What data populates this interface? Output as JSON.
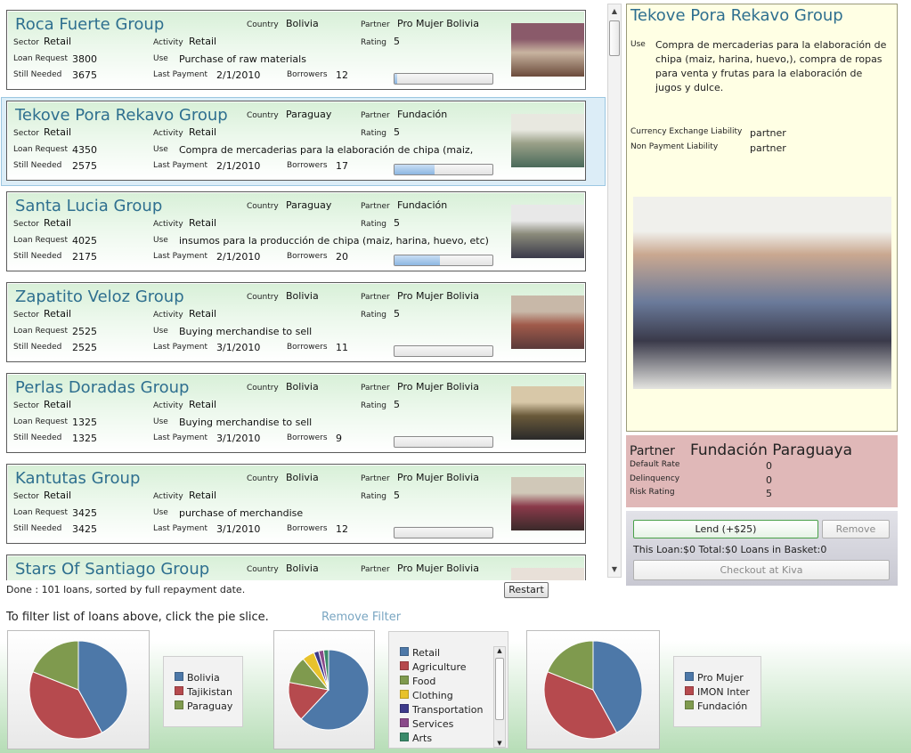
{
  "loans": [
    {
      "name": "Roca Fuerte Group",
      "country": "Bolivia",
      "partner": "Pro Mujer Bolivia",
      "sector": "Retail",
      "activity": "Retail",
      "rating": "5",
      "loan_request": "3800",
      "use": "Purchase of raw materials",
      "still_needed": "3675",
      "last_payment": "2/1/2010",
      "borrowers": "12",
      "funded_fraction": 0.03
    },
    {
      "name": "Tekove Pora Rekavo Group",
      "country": "Paraguay",
      "partner": "Fundación",
      "sector": "Retail",
      "activity": "Retail",
      "rating": "5",
      "loan_request": "4350",
      "use": "Compra de mercaderias para la elaboración de chipa (maiz,",
      "still_needed": "2575",
      "last_payment": "2/1/2010",
      "borrowers": "17",
      "funded_fraction": 0.41
    },
    {
      "name": "Santa Lucia Group",
      "country": "Paraguay",
      "partner": "Fundación",
      "sector": "Retail",
      "activity": "Retail",
      "rating": "5",
      "loan_request": "4025",
      "use": "insumos para la producción de chipa (maiz, harina, huevo, etc)",
      "still_needed": "2175",
      "last_payment": "2/1/2010",
      "borrowers": "20",
      "funded_fraction": 0.46
    },
    {
      "name": "Zapatito Veloz Group",
      "country": "Bolivia",
      "partner": "Pro Mujer Bolivia",
      "sector": "Retail",
      "activity": "Retail",
      "rating": "5",
      "loan_request": "2525",
      "use": "Buying merchandise to sell",
      "still_needed": "2525",
      "last_payment": "3/1/2010",
      "borrowers": "11",
      "funded_fraction": 0.0
    },
    {
      "name": "Perlas Doradas Group",
      "country": "Bolivia",
      "partner": "Pro Mujer Bolivia",
      "sector": "Retail",
      "activity": "Retail",
      "rating": "5",
      "loan_request": "1325",
      "use": "Buying merchandise to sell",
      "still_needed": "1325",
      "last_payment": "3/1/2010",
      "borrowers": "9",
      "funded_fraction": 0.0
    },
    {
      "name": "Kantutas Group",
      "country": "Bolivia",
      "partner": "Pro Mujer Bolivia",
      "sector": "Retail",
      "activity": "Retail",
      "rating": "5",
      "loan_request": "3425",
      "use": "purchase of merchandise",
      "still_needed": "3425",
      "last_payment": "3/1/2010",
      "borrowers": "12",
      "funded_fraction": 0.0
    },
    {
      "name": "Stars Of Santiago Group",
      "country": "Bolivia",
      "partner": "Pro Mujer Bolivia"
    }
  ],
  "labels": {
    "country": "Country",
    "partner": "Partner",
    "sector": "Sector",
    "activity": "Activity",
    "rating": "Rating",
    "loan_request": "Loan Request",
    "use": "Use",
    "still_needed": "Still Needed",
    "last_payment": "Last Payment",
    "borrowers": "Borrowers"
  },
  "status": {
    "text": "Done : 101 loans, sorted by full repayment date.",
    "restart": "Restart"
  },
  "filter": {
    "instruction": "To filter list of loans above, click the pie slice.",
    "remove": "Remove Filter"
  },
  "detail": {
    "title": "Tekove Pora Rekavo Group",
    "use_label": "Use",
    "use_text": "Compra de mercaderias para la elaboración de chipa (maiz, harina, huevo,), compra de ropas para venta y frutas para la elaboración de jugos y dulce.",
    "fx_label": "Currency Exchange Liability",
    "fx_value": "partner",
    "np_label": "Non Payment Liability",
    "np_value": "partner"
  },
  "partner_info": {
    "label": "Partner",
    "name": "Fundación Paraguaya",
    "default_rate_label": "Default Rate",
    "default_rate": "0",
    "delinquency_label": "Delinquency",
    "delinquency": "0",
    "risk_label": "Risk Rating",
    "risk": "5"
  },
  "basket": {
    "lend": "Lend (+$25)",
    "remove": "Remove",
    "summary": "This Loan:$0 Total:$0 Loans in Basket:0",
    "checkout": "Checkout at Kiva"
  },
  "pies": [
    {
      "name": "country",
      "slices": [
        {
          "label": "Bolivia",
          "value": 42,
          "color": "#4d78a8"
        },
        {
          "label": "Tajikistan",
          "value": 39,
          "color": "#b64a4e"
        },
        {
          "label": "Paraguay",
          "value": 19,
          "color": "#7f9a4e"
        }
      ]
    },
    {
      "name": "sector",
      "slices": [
        {
          "label": "Retail",
          "value": 62,
          "color": "#4d78a8"
        },
        {
          "label": "Agriculture",
          "value": 16,
          "color": "#b64a4e"
        },
        {
          "label": "Food",
          "value": 11,
          "color": "#7f9a4e"
        },
        {
          "label": "Clothing",
          "value": 5,
          "color": "#e8c22c"
        },
        {
          "label": "Transportation",
          "value": 2,
          "color": "#3d3a8a"
        },
        {
          "label": "Services",
          "value": 2,
          "color": "#8a4a8a"
        },
        {
          "label": "Arts",
          "value": 2,
          "color": "#3a8a6a"
        }
      ]
    },
    {
      "name": "partner",
      "slices": [
        {
          "label": "Pro Mujer",
          "value": 42,
          "color": "#4d78a8"
        },
        {
          "label": "IMON Inter",
          "value": 39,
          "color": "#b64a4e"
        },
        {
          "label": "Fundación",
          "value": 19,
          "color": "#7f9a4e"
        }
      ]
    }
  ],
  "colors": {
    "title": "#2e6f8f",
    "card_gradient_top": "#d8f0d8",
    "detail_bg": "#ffffe4",
    "partner_bg": "#e0b8b8",
    "selected_bg": "#dcedf7"
  }
}
